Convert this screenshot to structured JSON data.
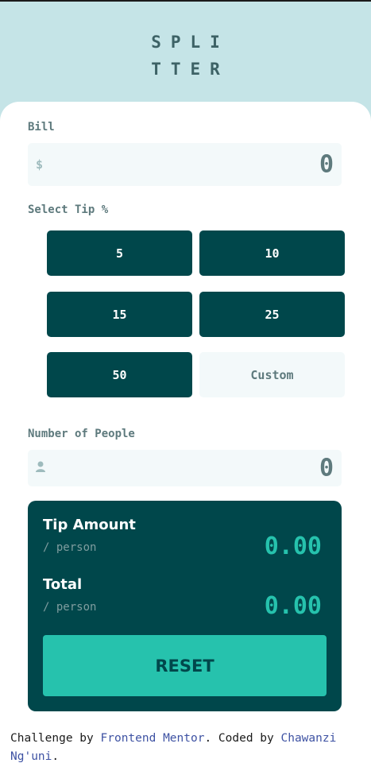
{
  "logo": {
    "line1": "SPLI",
    "line2": "TTER"
  },
  "bill": {
    "label": "Bill",
    "currency": "$",
    "value": "0"
  },
  "tip": {
    "label": "Select Tip %",
    "options": [
      "5",
      "10",
      "15",
      "25",
      "50"
    ],
    "custom_placeholder": "Custom"
  },
  "people": {
    "label": "Number of People",
    "icon": "person-icon",
    "value": "0"
  },
  "result": {
    "tip_amount_label": "Tip Amount",
    "tip_amount_sub": "/ person",
    "tip_amount_value": "0.00",
    "total_label": "Total",
    "total_sub": "/ person",
    "total_value": "0.00",
    "reset_label": "RESET"
  },
  "attribution": {
    "prefix": "Challenge by ",
    "link1": "Frontend Mentor",
    "middle": ". Coded by ",
    "link2": "Chawanzi Ng'uni",
    "suffix": "."
  },
  "colors": {
    "background": "#c5e4e7",
    "dark_cyan": "#00474b",
    "strong_cyan": "#26c2ad",
    "link": "#3e52a3"
  }
}
